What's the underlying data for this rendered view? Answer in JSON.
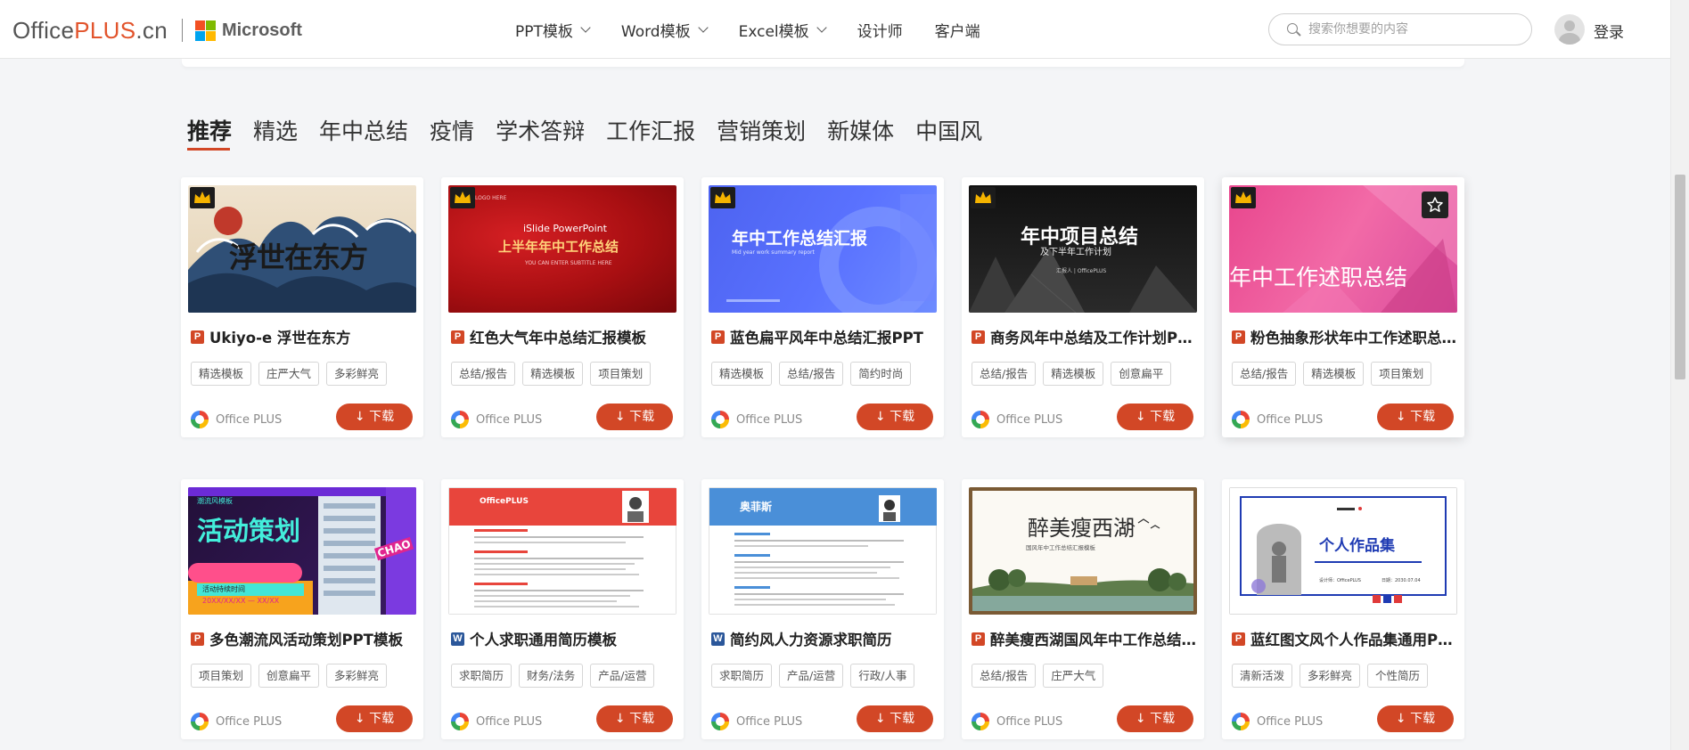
{
  "header": {
    "logo": {
      "part1": "Office",
      "part2": "PLUS",
      "part3": ".cn"
    },
    "microsoft": "Microsoft",
    "nav": [
      {
        "label": "PPT模板",
        "dropdown": true
      },
      {
        "label": "Word模板",
        "dropdown": true
      },
      {
        "label": "Excel模板",
        "dropdown": true
      },
      {
        "label": "设计师",
        "dropdown": false
      },
      {
        "label": "客户端",
        "dropdown": false
      }
    ],
    "search_placeholder": "搜索你想要的内容",
    "login": "登录"
  },
  "categories": {
    "active_index": 0,
    "items": [
      "推荐",
      "精选",
      "年中总结",
      "疫情",
      "学术答辩",
      "工作汇报",
      "营销策划",
      "新媒体",
      "中国风"
    ]
  },
  "download_label": "↓ 下载",
  "author_name": "Office PLUS",
  "accent_color": "#d24726",
  "cards": [
    {
      "type": "P",
      "title": "Ukiyo-e 浮世在东方",
      "tags": [
        "精选模板",
        "庄严大气",
        "多彩鲜亮"
      ],
      "premium": true,
      "thumb_texts": [
        "浮世在东方"
      ]
    },
    {
      "type": "P",
      "title": "红色大气年中总结汇报模板",
      "tags": [
        "总结/报告",
        "精选模板",
        "项目策划"
      ],
      "premium": true,
      "thumb_texts": [
        "iSlide PowerPoint",
        "上半年年中工作总结",
        "YOU CAN ENTER SUBTITLE HERE",
        "LOGO HERE"
      ]
    },
    {
      "type": "P",
      "title": "蓝色扁平风年中总结汇报PPT",
      "tags": [
        "精选模板",
        "总结/报告",
        "简约时尚"
      ],
      "premium": true,
      "thumb_texts": [
        "年中工作总结汇报",
        "Mid year work summary report"
      ]
    },
    {
      "type": "P",
      "title": "商务风年中总结及工作计划PPT",
      "tags": [
        "总结/报告",
        "精选模板",
        "创意扁平"
      ],
      "premium": true,
      "thumb_texts": [
        "年中项目总结",
        "及下半年工作计划",
        "汇报人 | OfficePLUS"
      ]
    },
    {
      "type": "P",
      "title": "粉色抽象形状年中工作述职总结PPT",
      "tags": [
        "总结/报告",
        "精选模板",
        "项目策划"
      ],
      "premium": true,
      "thumb_texts": [
        "年中工作述职总结"
      ]
    },
    {
      "type": "P",
      "title": "多色潮流风活动策划PPT模板",
      "tags": [
        "项目策划",
        "创意扁平",
        "多彩鲜亮"
      ],
      "premium": false,
      "thumb_texts": [
        "活动策划",
        "潮流风模板",
        "CHAO",
        "活动持续时间",
        "20XX/XX/XX — XX/XX"
      ]
    },
    {
      "type": "W",
      "title": "个人求职通用简历模板",
      "tags": [
        "求职简历",
        "财务/法务",
        "产品/运营"
      ],
      "premium": false,
      "thumb_texts": [
        "OfficePLUS"
      ]
    },
    {
      "type": "W",
      "title": "简约风人力资源求职简历",
      "tags": [
        "求职简历",
        "产品/运营",
        "行政/人事"
      ],
      "premium": false,
      "thumb_texts": [
        "奥菲斯"
      ]
    },
    {
      "type": "P",
      "title": "醉美瘦西湖国风年中工作总结PPT",
      "tags": [
        "总结/报告",
        "庄严大气"
      ],
      "premium": false,
      "thumb_texts": [
        "醉美瘦西湖",
        "国风年中工作总结汇报模板"
      ]
    },
    {
      "type": "P",
      "title": "蓝红图文风个人作品集通用PPT",
      "tags": [
        "清新活泼",
        "多彩鲜亮",
        "个性简历"
      ],
      "premium": false,
      "thumb_texts": [
        "个人作品集",
        "设计师：OfficePLUS",
        "日期：2030.07.04"
      ]
    }
  ]
}
